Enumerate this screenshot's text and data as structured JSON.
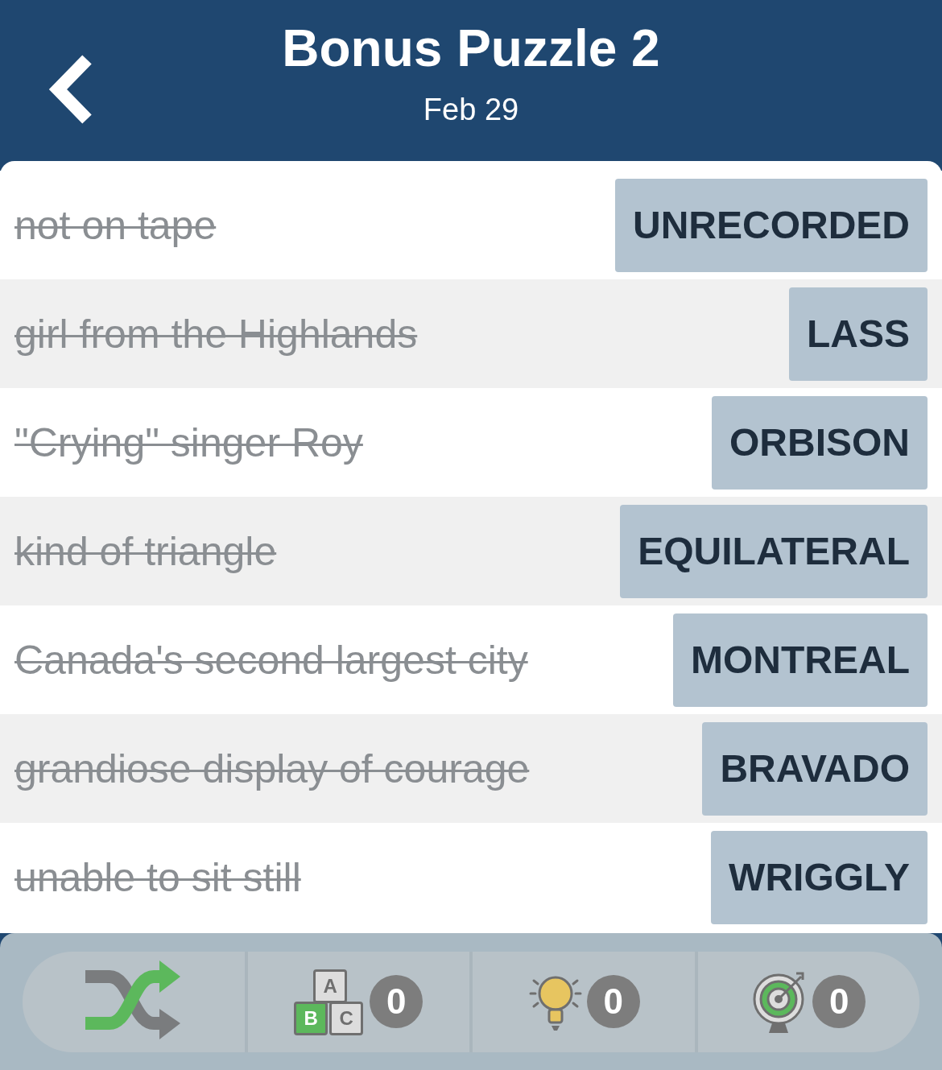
{
  "header": {
    "title": "Bonus Puzzle 2",
    "subtitle": "Feb 29"
  },
  "clues": [
    {
      "clue": "not on tape",
      "answer": "UNRECORDED",
      "solved": true
    },
    {
      "clue": "girl from the Highlands",
      "answer": "LASS",
      "solved": true
    },
    {
      "clue": "\"Crying\" singer Roy",
      "answer": "ORBISON",
      "solved": true
    },
    {
      "clue": "kind of triangle",
      "answer": "EQUILATERAL",
      "solved": true
    },
    {
      "clue": "Canada's second largest city",
      "answer": "MONTREAL",
      "solved": true
    },
    {
      "clue": "grandiose display of courage",
      "answer": "BRAVADO",
      "solved": true
    },
    {
      "clue": "unable to sit still",
      "answer": "WRIGGLY",
      "solved": true
    }
  ],
  "toolbar": [
    {
      "kind": "shuffle"
    },
    {
      "kind": "letters",
      "count": "0",
      "letters": [
        "A",
        "B",
        "C"
      ]
    },
    {
      "kind": "hint",
      "count": "0"
    },
    {
      "kind": "target",
      "count": "0"
    }
  ]
}
